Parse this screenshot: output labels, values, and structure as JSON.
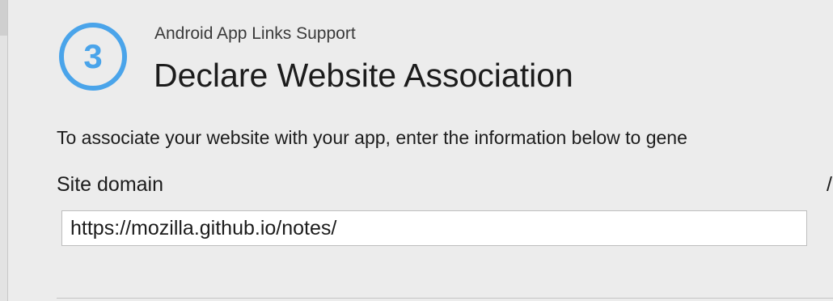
{
  "wizard": {
    "step_number": "3",
    "subtitle": "Android App Links Support",
    "title": "Declare Website Association",
    "description": "To associate your website with your app, enter the information below to gene",
    "edge_glyph": "/"
  },
  "form": {
    "site_domain_label": "Site domain",
    "site_domain_value": "https://mozilla.github.io/notes/"
  },
  "colors": {
    "accent": "#4aa4ea",
    "background": "#ececec"
  }
}
